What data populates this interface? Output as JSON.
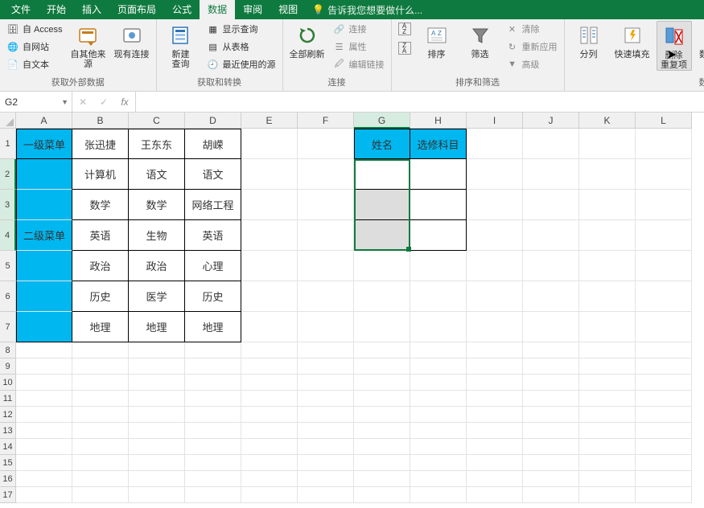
{
  "tabs": {
    "file": "文件",
    "home": "开始",
    "insert": "插入",
    "layout": "页面布局",
    "formulas": "公式",
    "data": "数据",
    "review": "审阅",
    "view": "视图",
    "tell_me": "告诉我您想要做什么..."
  },
  "ribbon": {
    "group_ext_data": "获取外部数据",
    "group_transform": "获取和转换",
    "group_connections": "连接",
    "group_sort_filter": "排序和筛选",
    "group_data_tools": "数据工",
    "from_access": "自 Access",
    "from_web": "自网站",
    "from_text": "自文本",
    "from_other": "自其他来源",
    "existing_conn": "现有连接",
    "new_query": "新建\n查询",
    "show_query": "显示查询",
    "from_table": "从表格",
    "recent_sources": "最近使用的源",
    "refresh_all": "全部刷新",
    "connections": "连接",
    "properties": "属性",
    "edit_links": "编辑链接",
    "sort_az": "A→Z",
    "sort_za": "Z→A",
    "sort": "排序",
    "filter": "筛选",
    "clear": "清除",
    "reapply": "重新应用",
    "advanced": "高级",
    "text_to_cols": "分列",
    "flash_fill": "快速填充",
    "remove_dup": "删除\n重复项",
    "data_validation": "数据验\n证"
  },
  "formula_bar": {
    "name_box": "G2",
    "fx": "fx",
    "value": ""
  },
  "columns": [
    "A",
    "B",
    "C",
    "D",
    "E",
    "F",
    "G",
    "H",
    "I",
    "J",
    "K",
    "L"
  ],
  "sheet": {
    "a1": "一级菜单",
    "b1": "张迅捷",
    "c1": "王东东",
    "d1": "胡嵘",
    "a2": "二级菜单",
    "b2": "计算机",
    "c2": "语文",
    "d2": "语文",
    "b3": "数学",
    "c3": "数学",
    "d3": "网络工程",
    "b4": "英语",
    "c4": "生物",
    "d4": "英语",
    "b5": "政治",
    "c5": "政治",
    "d5": "心理",
    "b6": "历史",
    "c6": "医学",
    "d6": "历史",
    "b7": "地理",
    "c7": "地理",
    "d7": "地理",
    "g1": "姓名",
    "h1": "选修科目"
  }
}
